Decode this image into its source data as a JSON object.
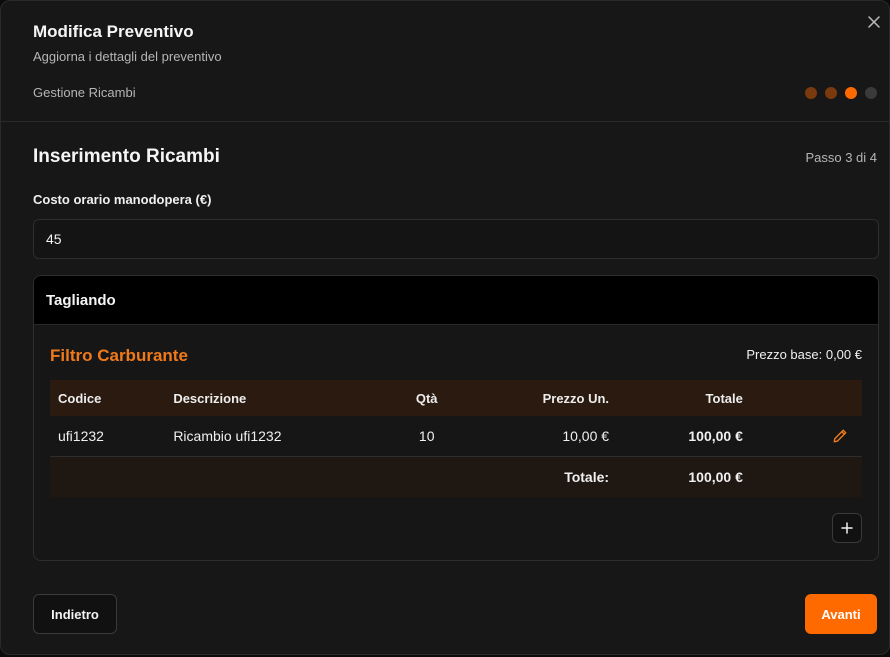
{
  "modal": {
    "title": "Modifica Preventivo",
    "subtitle": "Aggiorna i dettagli del preventivo",
    "step_name": "Gestione Ricambi",
    "close_icon": "close-icon"
  },
  "stepper": {
    "current_step": 3,
    "total_steps": 4,
    "dot_colors": [
      "#7a3a0d",
      "#7a3a0d",
      "#ff6a00",
      "#3a3a3a"
    ]
  },
  "section": {
    "title": "Inserimento Ricambi",
    "step_counter": "Passo 3 di 4"
  },
  "labor": {
    "label": "Costo orario manodopera (€)",
    "value": "45"
  },
  "service": {
    "name": "Tagliando",
    "part": {
      "title": "Filtro Carburante",
      "base_price": "Prezzo base: 0,00 €",
      "columns": [
        "Codice",
        "Descrizione",
        "Qtà",
        "Prezzo Un.",
        "Totale"
      ],
      "rows": [
        {
          "code": "ufi1232",
          "description": "Ricambio ufi1232",
          "qty": "10",
          "unit_price": "10,00 €",
          "total": "100,00 €"
        }
      ],
      "total_label": "Totale:",
      "total_value": "100,00 €"
    }
  },
  "footer": {
    "back_label": "Indietro",
    "next_label": "Avanti"
  },
  "colors": {
    "accent": "#ff6a00",
    "part_title": "#f07a1a"
  }
}
